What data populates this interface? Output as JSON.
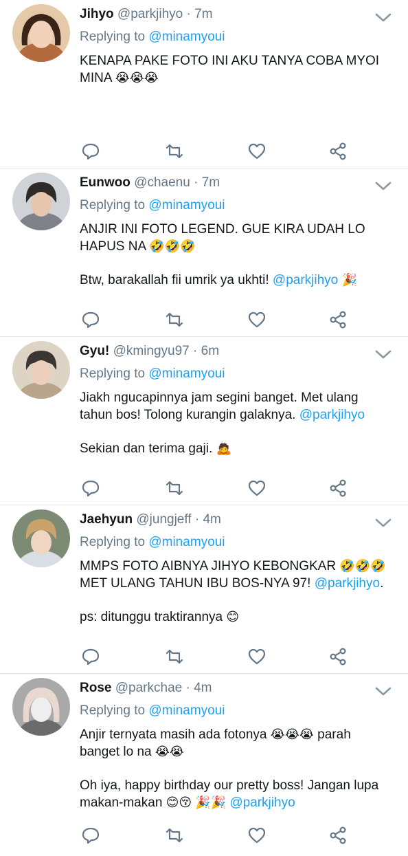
{
  "tweets": [
    {
      "name": "Jihyo",
      "handle": "@parkjihyo",
      "dot": "·",
      "time": "7m",
      "replying_label": "Replying to",
      "reply_to": "@minamyoui",
      "para1_text": "KENAPA PAKE FOTO INI AKU TANYA COBA MYOI MINA",
      "para1_emoji": "😭😭😭",
      "avatar_color": "#d9a27a"
    },
    {
      "name": "Eunwoo",
      "handle": "@chaenu",
      "dot": "·",
      "time": "7m",
      "replying_label": "Replying to",
      "reply_to": "@minamyoui",
      "para1_text": "ANJIR INI FOTO LEGEND. GUE KIRA UDAH LO HAPUS NA",
      "para1_emoji": "🤣🤣🤣",
      "para2_text": "Btw, barakallah fii umrik ya ukhti!",
      "para2_mention": "@parkjihyo",
      "para2_emoji": "🎉",
      "avatar_color": "#8a8f96"
    },
    {
      "name": "Gyu!",
      "handle": "@kmingyu97",
      "dot": "·",
      "time": "6m",
      "replying_label": "Replying to",
      "reply_to": "@minamyoui",
      "para1_text": "Jiakh ngucapinnya jam segini banget. Met ulang tahun bos! Tolong kurangin galaknya.",
      "para1_mention": "@parkjihyo",
      "para2_text": "Sekian dan terima gaji.",
      "para2_emoji": "🙇",
      "avatar_color": "#c9b7a0"
    },
    {
      "name": "Jaehyun",
      "handle": "@jungjeff",
      "dot": "·",
      "time": "4m",
      "replying_label": "Replying to",
      "reply_to": "@minamyoui",
      "para1_text": "MMPS FOTO AIBNYA JIHYO KEBONGKAR",
      "para1_emoji": "🤣🤣🤣",
      "para1_text2": "MET ULANG TAHUN IBU BOS-NYA 97!",
      "para1_mention": "@parkjihyo",
      "para1_tail": ".",
      "para2_text": "ps: ditunggu traktirannya",
      "para2_emoji": "😊",
      "avatar_color": "#6f7d6a"
    },
    {
      "name": "Rose",
      "handle": "@parkchae",
      "dot": "·",
      "time": "4m",
      "replying_label": "Replying to",
      "reply_to": "@minamyoui",
      "para1_text": "Anjir ternyata masih ada fotonya",
      "para1_emoji": "😭😭😭",
      "para1_text2": "parah banget lo na",
      "para1_emoji2": "😭😭",
      "para2_text": "Oh iya, happy birthday our pretty boss! Jangan lupa makan-makan",
      "para2_emoji": "😊😚 🎉🎉",
      "para2_mention": "@parkjihyo",
      "avatar_color": "#b9b9b9"
    }
  ],
  "icons": {
    "reply": "reply-icon",
    "retweet": "retweet-icon",
    "like": "heart-icon",
    "share": "share-icon",
    "caret": "chevron-down-icon"
  },
  "colors": {
    "text": "#14171a",
    "secondary": "#657786",
    "link": "#1da1f2",
    "divider": "#e1e8ed"
  }
}
